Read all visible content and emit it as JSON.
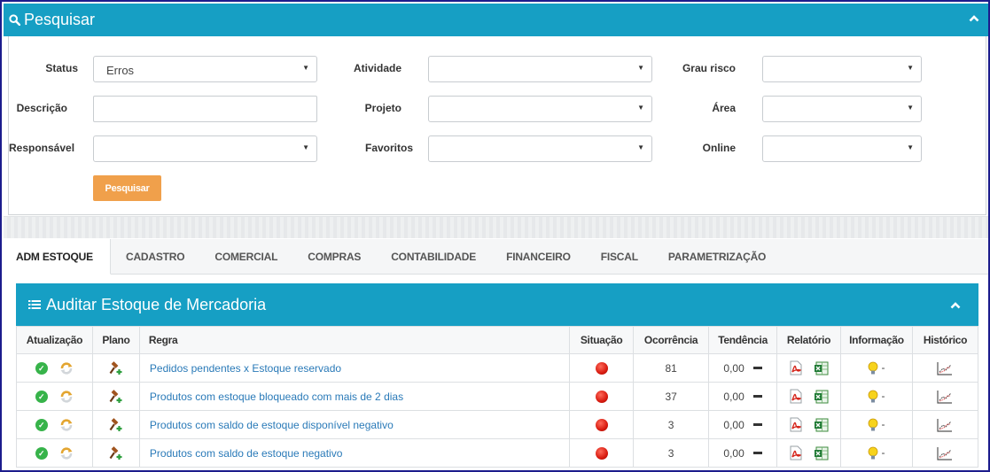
{
  "search": {
    "title": "Pesquisar",
    "fields": {
      "status_label": "Status",
      "status_value": "Erros",
      "atividade_label": "Atividade",
      "grau_risco_label": "Grau risco",
      "descricao_label": "Descrição",
      "projeto_label": "Projeto",
      "area_label": "Área",
      "responsavel_label": "Responsável",
      "favoritos_label": "Favoritos",
      "online_label": "Online"
    },
    "button_label": "Pesquisar"
  },
  "tabs": [
    "ADM ESTOQUE",
    "CADASTRO",
    "COMERCIAL",
    "COMPRAS",
    "CONTABILIDADE",
    "FINANCEIRO",
    "FISCAL",
    "PARAMETRIZAÇÃO"
  ],
  "audit": {
    "title": "Auditar Estoque de Mercadoria",
    "columns": [
      "Atualização",
      "Plano",
      "Regra",
      "Situação",
      "Ocorrência",
      "Tendência",
      "Relatório",
      "Informação",
      "Histórico"
    ],
    "rows": [
      {
        "regra": "Pedidos pendentes x Estoque reservado",
        "ocorrencia": "81",
        "tendencia": "0,00",
        "informacao": "-"
      },
      {
        "regra": "Produtos com estoque bloqueado com mais de 2 dias",
        "ocorrencia": "37",
        "tendencia": "0,00",
        "informacao": "-"
      },
      {
        "regra": "Produtos com saldo de estoque disponível negativo",
        "ocorrencia": "3",
        "tendencia": "0,00",
        "informacao": "-"
      },
      {
        "regra": "Produtos com saldo de estoque negativo",
        "ocorrencia": "3",
        "tendencia": "0,00",
        "informacao": "-"
      }
    ]
  },
  "colors": {
    "header_blue": "#169fc4",
    "button_orange": "#f0a04b",
    "link_blue": "#2a7ab8",
    "ok_green": "#37b34a",
    "alert_red": "#d81b10"
  },
  "icons": {
    "search": "search-icon",
    "collapse": "chevron-up-icon",
    "list": "list-icon",
    "ok": "check-circle-icon",
    "refresh": "refresh-icon",
    "plan": "gavel-plus-icon",
    "situation": "red-status-icon",
    "pdf": "pdf-icon",
    "excel": "excel-icon",
    "info": "lightbulb-icon",
    "history": "chart-history-icon"
  }
}
